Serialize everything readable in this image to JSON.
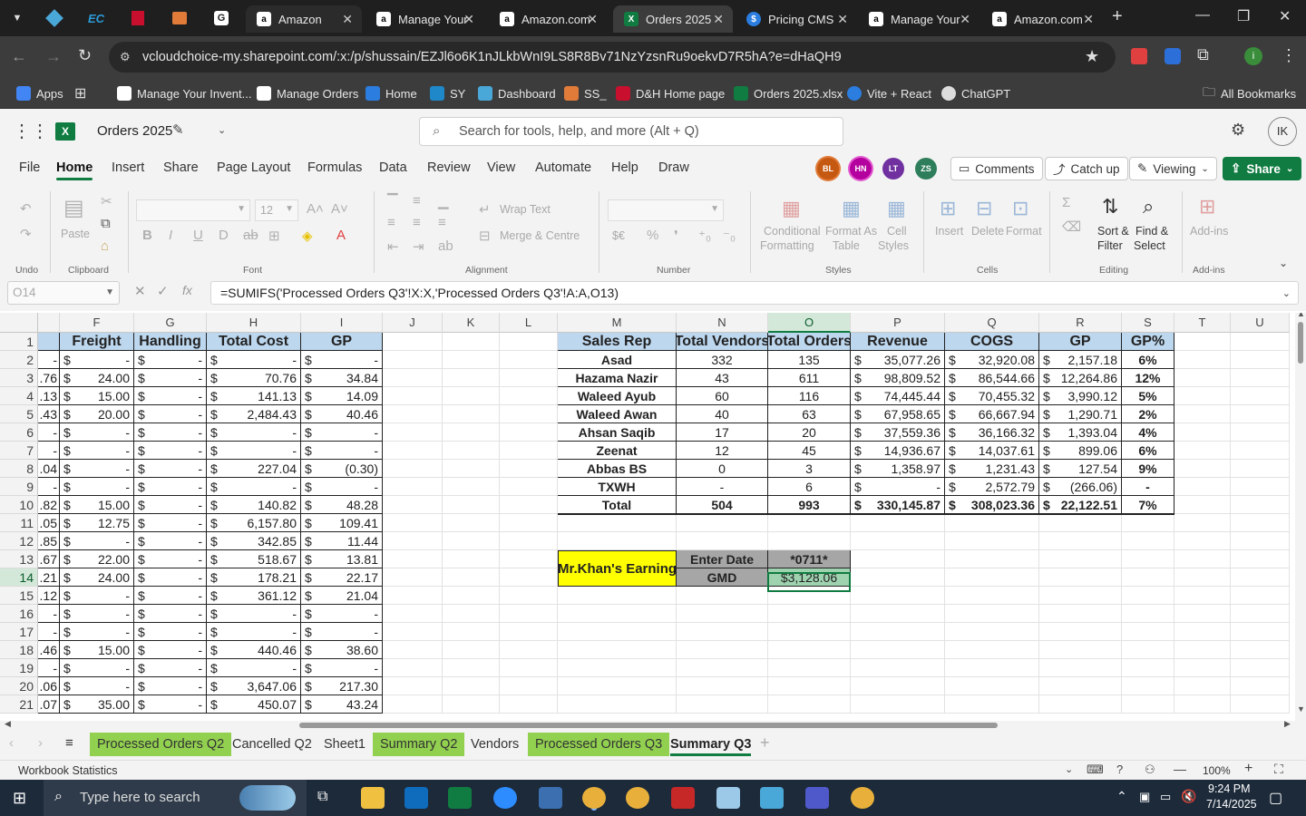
{
  "browser": {
    "tabs": [
      {
        "title": "Amazon",
        "icon": "amazon-icon",
        "active": false
      },
      {
        "title": "Manage Your",
        "icon": "amazon-icon",
        "active": false
      },
      {
        "title": "Amazon.com",
        "icon": "amazon-icon",
        "active": false
      },
      {
        "title": "Orders 2025",
        "icon": "excel-icon",
        "active": true
      },
      {
        "title": "Pricing CMS",
        "icon": "dollar-icon",
        "active": false
      },
      {
        "title": "Manage Your",
        "icon": "amazon-icon",
        "active": false
      },
      {
        "title": "Amazon.com",
        "icon": "amazon-icon",
        "active": false
      }
    ],
    "url": "vcloudchoice-my.sharepoint.com/:x:/p/shussain/EZJl6o6K1nJLkbWnI9LS8R8Bv71NzYzsnRu9oekvD7R5hA?e=dHaQH9",
    "bookmarks": [
      {
        "label": "Apps"
      },
      {
        "label": ""
      },
      {
        "label": "Manage Your Invent..."
      },
      {
        "label": "Manage Orders"
      },
      {
        "label": "Home"
      },
      {
        "label": "SY"
      },
      {
        "label": "Dashboard"
      },
      {
        "label": "SS_"
      },
      {
        "label": "D&H Home page"
      },
      {
        "label": "Orders 2025.xlsx"
      },
      {
        "label": "Vite + React"
      },
      {
        "label": "ChatGPT"
      }
    ],
    "all_bookmarks": "All Bookmarks"
  },
  "excel": {
    "doc_title": "Orders 2025",
    "search_placeholder": "Search for tools, help, and more (Alt + Q)",
    "user_initials": "IK",
    "menu": [
      "File",
      "Home",
      "Insert",
      "Share",
      "Page Layout",
      "Formulas",
      "Data",
      "Review",
      "View",
      "Automate",
      "Help",
      "Draw"
    ],
    "collaborators": [
      {
        "initials": "BL",
        "color": "#c65911"
      },
      {
        "initials": "HN",
        "color": "#b4009e"
      },
      {
        "initials": "LT",
        "color": "#7030a0"
      },
      {
        "initials": "ZS",
        "color": "#2e7d5b"
      }
    ],
    "buttons": {
      "comments": "Comments",
      "catchup": "Catch up",
      "viewing": "Viewing",
      "share": "Share"
    },
    "ribbon": {
      "paste": "Paste",
      "clipboard": "Clipboard",
      "undo": "Undo",
      "font": "Font",
      "font_size": "12",
      "wrap_text": "Wrap Text",
      "merge_centre": "Merge & Centre",
      "alignment": "Alignment",
      "number": "Number",
      "currency": "$€",
      "cond1": "Conditional",
      "cond2": "Formatting",
      "fmt1": "Format As",
      "fmt2": "Table",
      "cs1": "Cell",
      "cs2": "Styles",
      "styles": "Styles",
      "insert": "Insert",
      "delete": "Delete",
      "format": "Format",
      "cells": "Cells",
      "sort1": "Sort &",
      "sort2": "Filter",
      "find1": "Find &",
      "find2": "Select",
      "editing": "Editing",
      "addins": "Add-ins",
      "addins_grp": "Add-ins"
    },
    "namebox": "O14",
    "formula": "=SUMIFS('Processed Orders Q3'!X:X,'Processed Orders Q3'!A:A,O13)",
    "columns": [
      "F",
      "G",
      "H",
      "I",
      "J",
      "K",
      "L",
      "M",
      "N",
      "O",
      "P",
      "Q",
      "R",
      "S",
      "T",
      "U"
    ],
    "rows": [
      "1",
      "2",
      "3",
      "4",
      "5",
      "6",
      "7",
      "8",
      "9",
      "10",
      "11",
      "12",
      "13",
      "14",
      "15",
      "16",
      "17",
      "18",
      "19",
      "20",
      "21"
    ],
    "left_table": {
      "headers": [
        "Freight",
        "Handling",
        "Total Cost",
        "GP"
      ],
      "partial": [
        "",
        "-",
        ".76",
        ".13",
        ".43",
        "-",
        "-",
        ".04",
        "-",
        ".82",
        ".05",
        ".85",
        ".67",
        ".21",
        ".12",
        "-",
        "-",
        ".46",
        "-",
        ".06",
        ".07"
      ],
      "freight": [
        "",
        "-",
        "24.00",
        "15.00",
        "20.00",
        "-",
        "-",
        "-",
        "-",
        "15.00",
        "12.75",
        "-",
        "22.00",
        "24.00",
        "-",
        "-",
        "-",
        "15.00",
        "-",
        "-",
        "35.00"
      ],
      "handling": [
        "",
        "-",
        "-",
        "-",
        "-",
        "-",
        "-",
        "-",
        "-",
        "-",
        "-",
        "-",
        "-",
        "-",
        "-",
        "-",
        "-",
        "-",
        "-",
        "-",
        "-"
      ],
      "total_cost": [
        "",
        "-",
        "70.76",
        "141.13",
        "2,484.43",
        "-",
        "-",
        "227.04",
        "-",
        "140.82",
        "6,157.80",
        "342.85",
        "518.67",
        "178.21",
        "361.12",
        "-",
        "-",
        "440.46",
        "-",
        "3,647.06",
        "450.07"
      ],
      "gp": [
        "",
        "-",
        "34.84",
        "14.09",
        "40.46",
        "-",
        "-",
        "(0.30)",
        "-",
        "48.28",
        "109.41",
        "11.44",
        "13.81",
        "22.17",
        "21.04",
        "-",
        "-",
        "38.60",
        "-",
        "217.30",
        "43.24"
      ]
    },
    "summary_table": {
      "headers": [
        "Sales Rep",
        "Total Vendors",
        "Total Orders",
        "Revenue",
        "COGS",
        "GP",
        "GP%"
      ],
      "rows": [
        [
          "Asad",
          "332",
          "135",
          "35,077.26",
          "32,920.08",
          "2,157.18",
          "6%"
        ],
        [
          "Hazama Nazir",
          "43",
          "611",
          "98,809.52",
          "86,544.66",
          "12,264.86",
          "12%"
        ],
        [
          "Waleed Ayub",
          "60",
          "116",
          "74,445.44",
          "70,455.32",
          "3,990.12",
          "5%"
        ],
        [
          "Waleed Awan",
          "40",
          "63",
          "67,958.65",
          "66,667.94",
          "1,290.71",
          "2%"
        ],
        [
          "Ahsan Saqib",
          "17",
          "20",
          "37,559.36",
          "36,166.32",
          "1,393.04",
          "4%"
        ],
        [
          "Zeenat",
          "12",
          "45",
          "14,936.67",
          "14,037.61",
          "899.06",
          "6%"
        ],
        [
          "Abbas BS",
          "0",
          "3",
          "1,358.97",
          "1,231.43",
          "127.54",
          "9%"
        ],
        [
          "TXWH",
          "-",
          "6",
          "-",
          "2,572.79",
          "(266.06)",
          "-"
        ],
        [
          "Total",
          "504",
          "993",
          "330,145.87",
          "308,023.36",
          "22,122.51",
          "7%"
        ]
      ]
    },
    "earning": {
      "title": "Mr.Khan's Earning",
      "date_label": "Enter Date",
      "date_value": "*0711*",
      "gmd_label": "GMD",
      "gmd_value": "$3,128.06"
    },
    "currency_symbol": "$",
    "sheets": [
      {
        "name": "Processed Orders Q2",
        "color": "green"
      },
      {
        "name": "Cancelled Q2",
        "color": "none"
      },
      {
        "name": "Sheet1",
        "color": "none"
      },
      {
        "name": "Summary Q2",
        "color": "green"
      },
      {
        "name": "Vendors",
        "color": "none"
      },
      {
        "name": "Processed Orders Q3",
        "color": "green"
      },
      {
        "name": "Summary Q3",
        "color": "active"
      }
    ],
    "status_left": "Workbook Statistics",
    "zoom": "100%"
  },
  "taskbar": {
    "search_placeholder": "Type here to search",
    "time": "9:24 PM",
    "date": "7/14/2025"
  }
}
